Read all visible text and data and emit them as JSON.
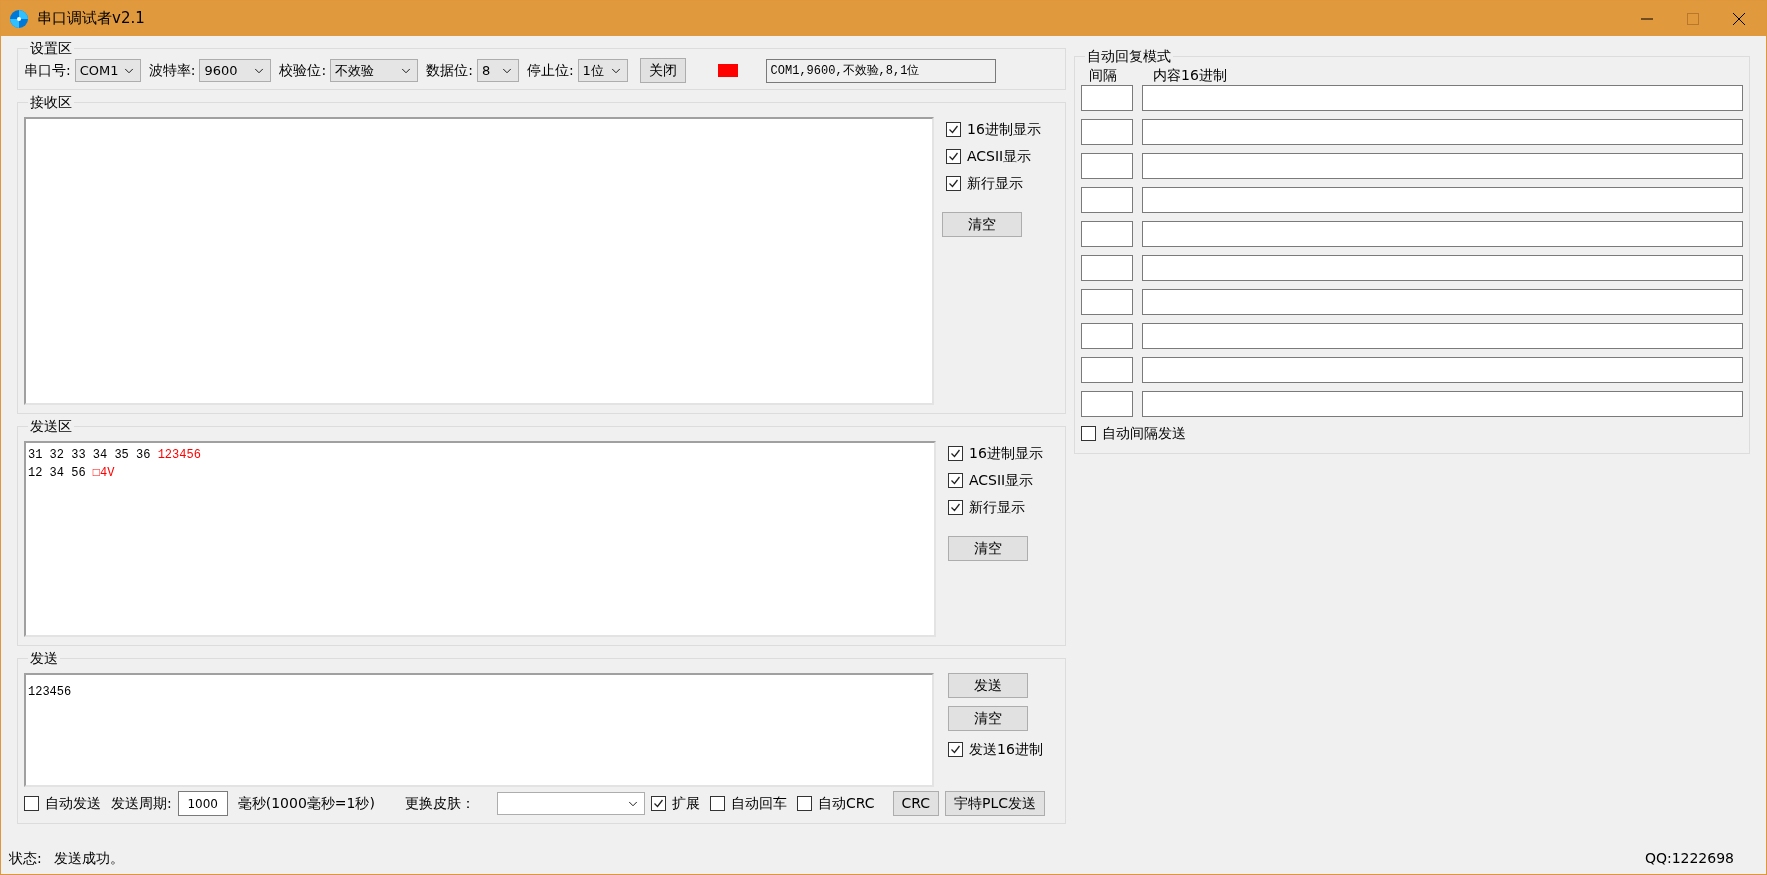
{
  "window": {
    "title": "串口调试者v2.1",
    "maximize_disabled": true
  },
  "settings": {
    "title": "设置区",
    "fields": [
      {
        "label": "串口号:",
        "value": "COM1"
      },
      {
        "label": "波特率:",
        "value": "9600"
      },
      {
        "label": "校验位:",
        "value": "不效验"
      },
      {
        "label": "数据位:",
        "value": "8"
      },
      {
        "label": "停止位:",
        "value": "1位"
      }
    ],
    "button": "关闭",
    "indicator": {
      "color": "#ff0000"
    },
    "summary": "COM1,9600,不效验,8,1位"
  },
  "receive": {
    "title": "接收区",
    "options": [
      {
        "label": "16进制显示",
        "checked": true
      },
      {
        "label": "ACSII显示",
        "checked": true
      },
      {
        "label": "新行显示",
        "checked": true
      }
    ],
    "clear_button": "清空"
  },
  "send_area": {
    "title": "发送区",
    "lines": [
      [
        {
          "text": "31 32 33 34 35 36 ",
          "color": "#000000"
        },
        {
          "text": "123456",
          "color": "#ff0000"
        }
      ],
      [
        {
          "text": "12 34 56 ",
          "color": "#000000"
        },
        {
          "text": "□4V",
          "color": "#ff0000"
        }
      ]
    ],
    "options": [
      {
        "label": "16进制显示",
        "checked": true
      },
      {
        "label": "ACSII显示",
        "checked": true
      },
      {
        "label": "新行显示",
        "checked": true
      }
    ],
    "clear_button": "清空"
  },
  "send": {
    "title": "发送",
    "value": "123456",
    "buttons": [
      "发送",
      "清空"
    ],
    "hex_option": {
      "label": "发送16进制",
      "checked": true
    },
    "bottom": [
      {
        "kind": "checkbox",
        "label": "自动发送",
        "checked": false
      },
      {
        "kind": "label",
        "text": "发送周期:"
      },
      {
        "kind": "input",
        "value": "1000"
      },
      {
        "kind": "label",
        "text": "毫秒(1000毫秒=1秒)"
      },
      {
        "kind": "label",
        "text": "更换皮肤："
      },
      {
        "kind": "dropdown"
      },
      {
        "kind": "checkbox",
        "label": "扩展",
        "checked": true
      },
      {
        "kind": "checkbox",
        "label": "自动回车",
        "checked": false
      },
      {
        "kind": "checkbox",
        "label": "自动CRC",
        "checked": false
      },
      {
        "kind": "button",
        "label": "CRC"
      },
      {
        "kind": "button",
        "label": "宇特PLC发送"
      }
    ]
  },
  "auto_reply": {
    "title": "自动回复模式",
    "columns": [
      "间隔",
      "内容16进制"
    ],
    "auto_send": {
      "label": "自动间隔发送",
      "checked": false
    }
  },
  "status_bar": {
    "label": "状态:",
    "message": "发送成功。",
    "qq": "QQ:1222698"
  }
}
